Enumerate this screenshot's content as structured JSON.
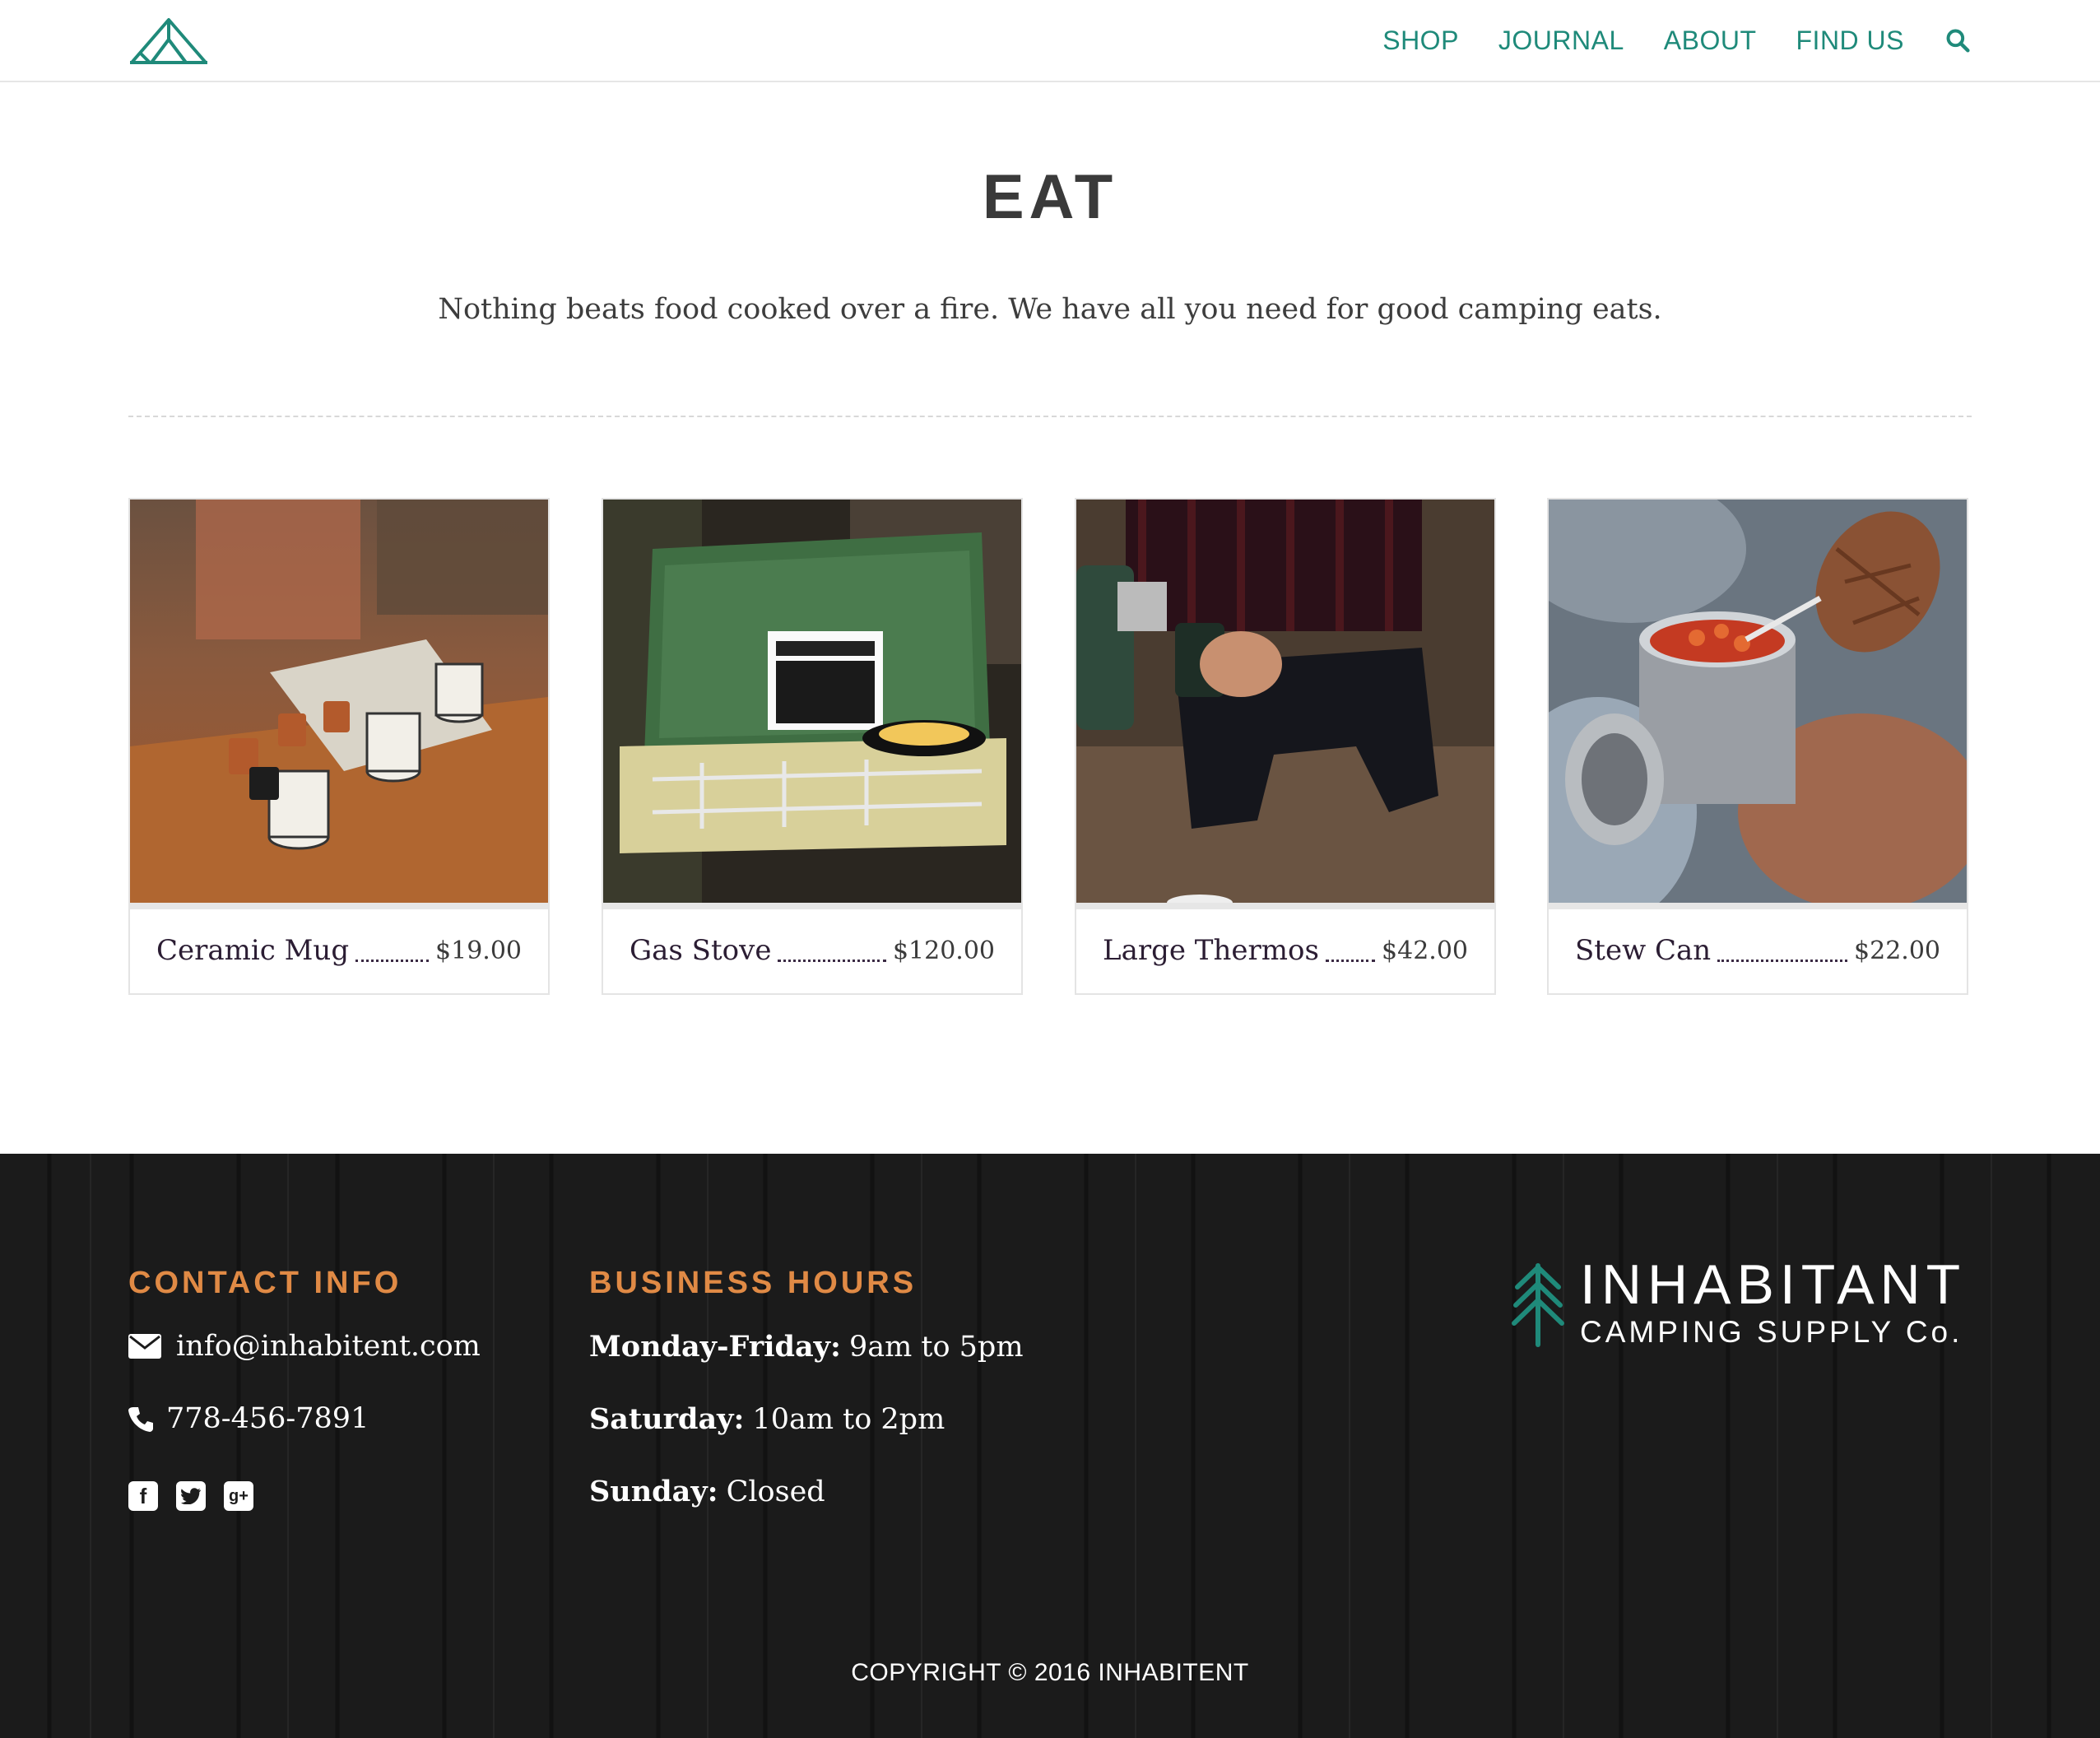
{
  "header": {
    "logo_name": "tent-logo",
    "nav": [
      {
        "label": "SHOP"
      },
      {
        "label": "JOURNAL"
      },
      {
        "label": "ABOUT"
      },
      {
        "label": "FIND US"
      }
    ],
    "search_icon": "search-icon",
    "accent_color": "#1f8a7a"
  },
  "page": {
    "title": "EAT",
    "subtitle": "Nothing beats food cooked over a fire. We have all you need for good camping eats."
  },
  "products": [
    {
      "name": "Ceramic Mug",
      "price": "$19.00"
    },
    {
      "name": "Gas Stove",
      "price": "$120.00"
    },
    {
      "name": "Large Thermos",
      "price": "$42.00"
    },
    {
      "name": "Stew Can",
      "price": "$22.00"
    }
  ],
  "footer": {
    "contact": {
      "heading": "CONTACT INFO",
      "email": "info@inhabitent.com",
      "phone": "778-456-7891",
      "social": [
        "facebook-icon",
        "twitter-icon",
        "google-plus-icon"
      ]
    },
    "hours": {
      "heading": "BUSINESS HOURS",
      "rows": [
        {
          "day": "Monday-Friday:",
          "time": "9am to 5pm"
        },
        {
          "day": "Saturday:",
          "time": "10am to 2pm"
        },
        {
          "day": "Sunday:",
          "time": "Closed"
        }
      ]
    },
    "brand": {
      "name": "INHABITANT",
      "tagline": "CAMPING SUPPLY Co."
    },
    "copyright": "COPYRIGHT © 2016 INHABITENT",
    "heading_color": "#e08a45"
  }
}
